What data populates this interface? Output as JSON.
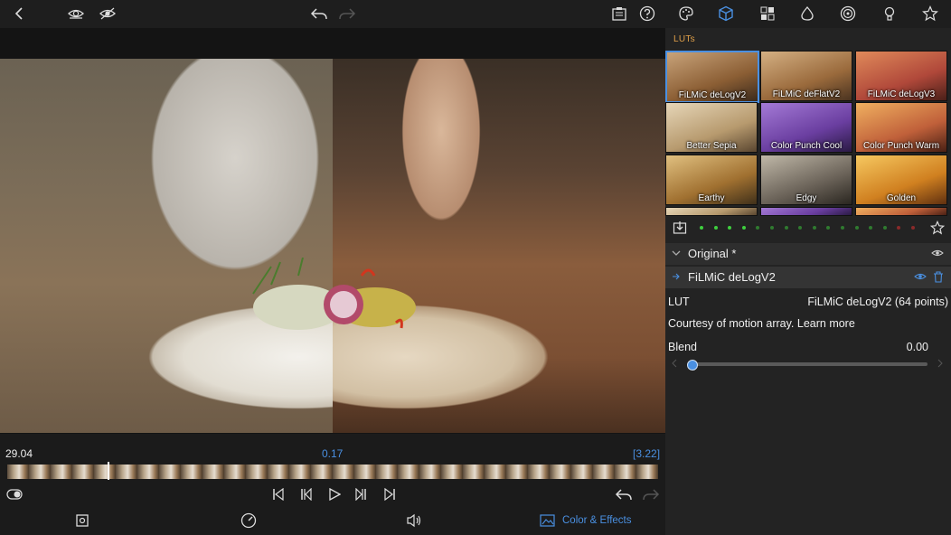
{
  "timeline": {
    "current_time": "29.04",
    "position": "0.17",
    "duration": "[3.22]"
  },
  "bottom_bar": {
    "color_effects_label": "Color & Effects"
  },
  "luts_panel": {
    "section_label": "LUTs",
    "thumbnails": [
      {
        "label": "FiLMiC deLogV2",
        "selected": true
      },
      {
        "label": "FiLMiC deFlatV2",
        "selected": false
      },
      {
        "label": "FiLMiC deLogV3",
        "selected": false
      },
      {
        "label": "Better Sepia",
        "selected": false
      },
      {
        "label": "Color Punch Cool",
        "selected": false
      },
      {
        "label": "Color Punch Warm",
        "selected": false
      },
      {
        "label": "Earthy",
        "selected": false
      },
      {
        "label": "Edgy",
        "selected": false
      },
      {
        "label": "Golden",
        "selected": false
      }
    ],
    "layers": {
      "original_label": "Original *",
      "active_label": "FiLMiC deLogV2"
    },
    "details": {
      "lut_key": "LUT",
      "lut_value": "FiLMiC deLogV2 (64 points)",
      "credit_text": "Courtesy of motion array. Learn more",
      "blend_key": "Blend",
      "blend_value": "0.00"
    },
    "blend_level": 0.0
  },
  "colors": {
    "accent": "#4a90e2",
    "section_label": "#e0a049",
    "dot_active": "#3ecf3e",
    "dot_dim": "#2f7a2f",
    "dot_red": "#8a2a2a"
  }
}
